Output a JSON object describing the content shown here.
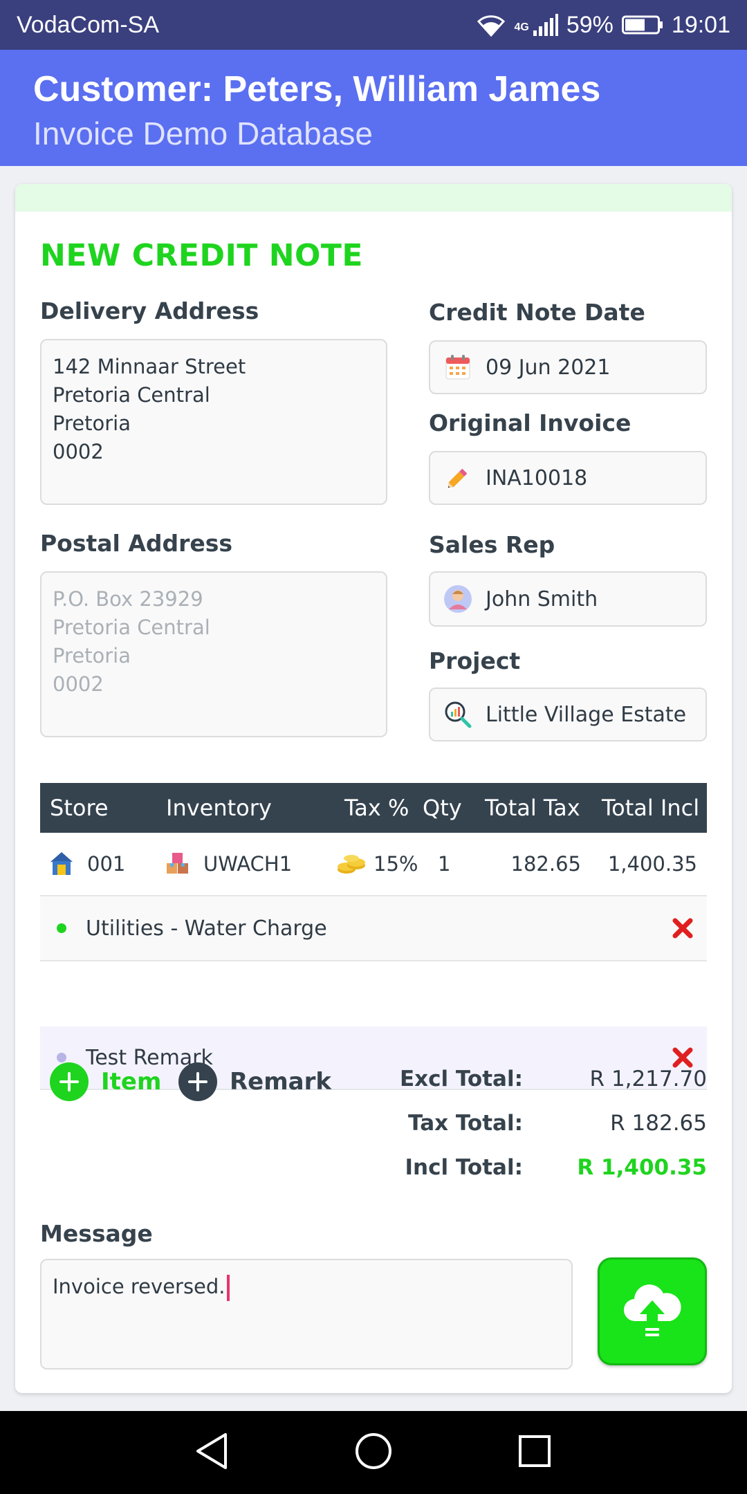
{
  "status_bar": {
    "carrier": "VodaCom-SA",
    "network": "4G",
    "battery": "59%",
    "time": "19:01"
  },
  "header": {
    "title": "Customer: Peters, William James",
    "subtitle": "Invoice Demo Database"
  },
  "form": {
    "heading": "NEW CREDIT NOTE",
    "delivery_label": "Delivery Address",
    "delivery_lines": [
      "142 Minnaar Street",
      "Pretoria Central",
      "Pretoria",
      "0002"
    ],
    "postal_label": "Postal Address",
    "postal_lines": [
      "P.O. Box 23929",
      "Pretoria Central",
      "Pretoria",
      "0002"
    ],
    "date_label": "Credit Note Date",
    "date_value": "09 Jun 2021",
    "invoice_label": "Original Invoice",
    "invoice_value": "INA10018",
    "rep_label": "Sales Rep",
    "rep_value": "John Smith",
    "project_label": "Project",
    "project_value": "Little Village Estate"
  },
  "table": {
    "headers": {
      "store": "Store",
      "inventory": "Inventory",
      "tax": "Tax %",
      "qty": "Qty",
      "total_tax": "Total Tax",
      "total_incl": "Total Incl"
    },
    "row": {
      "store": "001",
      "inventory": "UWACH1",
      "tax": "15%",
      "qty": "1",
      "total_tax": "182.65",
      "total_incl": "1,400.35"
    },
    "lines": [
      {
        "text": "Utilities - Water Charge",
        "dot_color": "#1fd41f"
      },
      {
        "text": "Test Remark",
        "dot_color": "#b8b4e6"
      }
    ]
  },
  "actions": {
    "item_label": "Item",
    "remark_label": "Remark"
  },
  "totals": {
    "excl_label": "Excl Total:",
    "excl_value": "R 1,217.70",
    "tax_label": "Tax Total:",
    "tax_value": "R 182.65",
    "incl_label": "Incl Total:",
    "incl_value": "R 1,400.35"
  },
  "message": {
    "label": "Message",
    "value": "Invoice reversed."
  },
  "colors": {
    "accent_green": "#1fd41f",
    "header_blue": "#5b6ff1",
    "status_blue": "#3a3f7e",
    "table_header": "#35434f",
    "delete_red": "#e02020"
  }
}
